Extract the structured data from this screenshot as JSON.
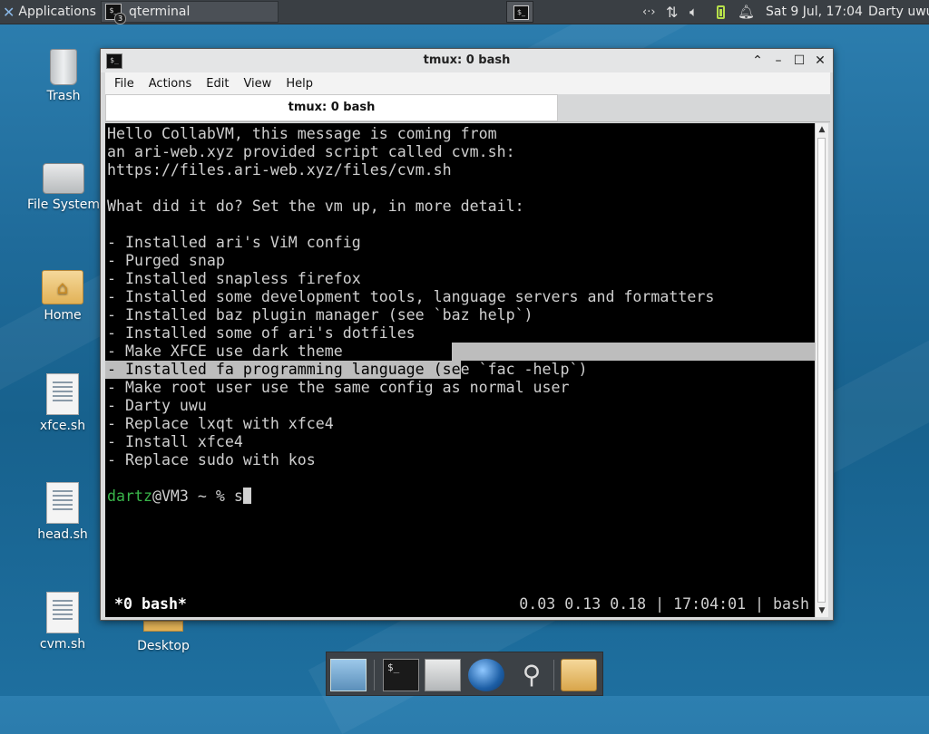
{
  "top_panel": {
    "applications_label": "Applications",
    "task_button_label": "qterminal",
    "task_badge": "3",
    "tray_net_glyph": "‹·›",
    "clock": "Sat  9 Jul, 17:04",
    "user": "Darty uwu"
  },
  "desktop": {
    "icons": [
      {
        "label": "Trash",
        "icon": "trash-icon"
      },
      {
        "label": "File System",
        "icon": "drive-icon"
      },
      {
        "label": "Home",
        "icon": "home-folder-icon"
      },
      {
        "label": "xfce.sh",
        "icon": "script-file-icon"
      },
      {
        "label": "head.sh",
        "icon": "script-file-icon"
      },
      {
        "label": "cvm.sh",
        "icon": "script-file-icon"
      },
      {
        "label": "Desktop",
        "icon": "folder-icon"
      }
    ]
  },
  "window": {
    "title": "tmux: 0 bash",
    "menu": [
      "File",
      "Actions",
      "Edit",
      "View",
      "Help"
    ],
    "tab_label": "tmux: 0 bash"
  },
  "terminal": {
    "lines": [
      "Hello CollabVM, this message is coming from",
      "an ari-web.xyz provided script called cvm.sh:",
      "https://files.ari-web.xyz/files/cvm.sh",
      "",
      "What did it do? Set the vm up, in more detail:",
      "",
      "- Installed ari's ViM config",
      "- Purged snap",
      "- Installed snapless firefox",
      "- Installed some development tools, language servers and formatters",
      "- Installed baz plugin manager (see `baz help`)",
      "- Installed some of ari's dotfiles",
      "- Make XFCE use dark theme",
      "",
      "- Make root user use the same config as normal user",
      "- Darty uwu",
      "- Replace lxqt with xfce4",
      "- Install xfce4",
      "- Replace sudo with kos"
    ],
    "selected_line_selected_part": "- Installed fa programming language (se",
    "selected_line_rest": "e `fac -help`)",
    "prompt_user": "dartz",
    "prompt_rest": "@VM3 ~ % ",
    "prompt_input": "s",
    "status_left": "*0 bash*",
    "status_right": "0.03 0.13 0.18 | 17:04:01 | bash"
  }
}
